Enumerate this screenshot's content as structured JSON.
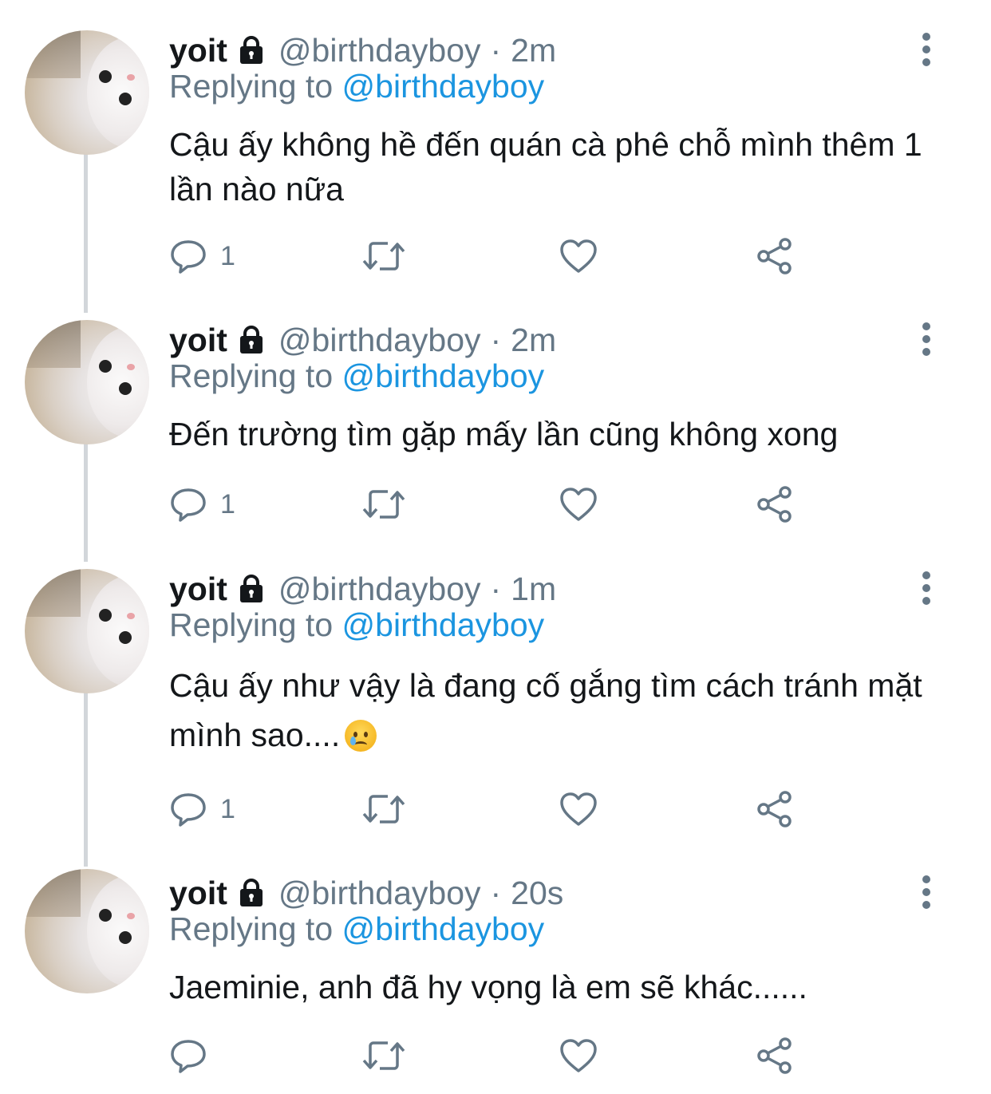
{
  "colors": {
    "text": "#14171a",
    "secondary": "#657786",
    "link": "#1b95e0",
    "thread_line": "#d2d6da"
  },
  "tweets": [
    {
      "name": "yoit",
      "handle": "@birthdayboy",
      "separator": "·",
      "time": "2m",
      "replying_prefix": "Replying to",
      "replying_to": "@birthdayboy",
      "text": "Cậu ấy không hề đến quán cà phê chỗ mình thêm 1 lần nào nữa",
      "reply_count": "1"
    },
    {
      "name": "yoit",
      "handle": "@birthdayboy",
      "separator": "·",
      "time": "2m",
      "replying_prefix": "Replying to",
      "replying_to": "@birthdayboy",
      "text": "Đến trường tìm gặp mấy lần cũng không xong",
      "reply_count": "1"
    },
    {
      "name": "yoit",
      "handle": "@birthdayboy",
      "separator": "·",
      "time": "1m",
      "replying_prefix": "Replying to",
      "replying_to": "@birthdayboy",
      "text": "Cậu ấy như vậy là đang cố gắng tìm cách tránh mặt mình sao....",
      "emoji": "crying-face",
      "reply_count": "1"
    },
    {
      "name": "yoit",
      "handle": "@birthdayboy",
      "separator": "·",
      "time": "20s",
      "replying_prefix": "Replying to",
      "replying_to": "@birthdayboy",
      "text": "Jaeminie, anh đã hy vọng là em sẽ khác......",
      "reply_count": ""
    }
  ],
  "icons": {
    "lock": "lock-icon",
    "more": "more-vertical-icon",
    "reply": "reply-icon",
    "retweet": "retweet-icon",
    "like": "heart-icon",
    "share": "share-icon"
  }
}
